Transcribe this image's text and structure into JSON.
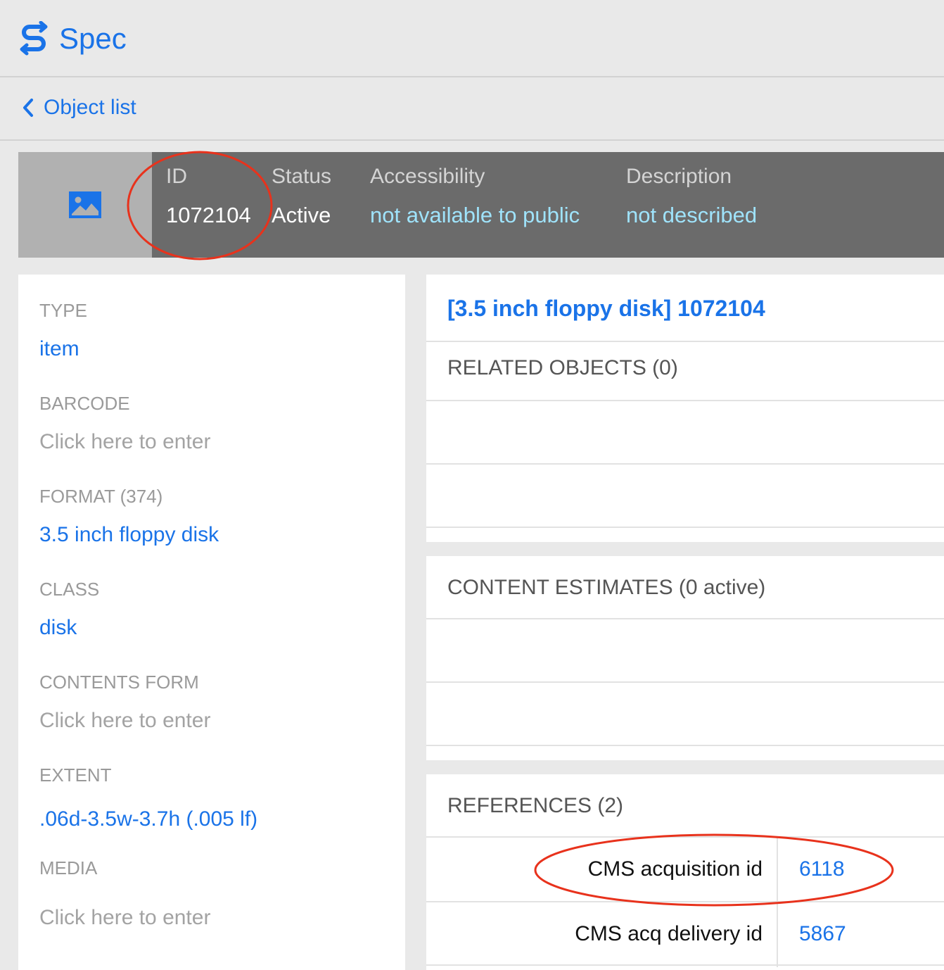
{
  "app": {
    "name": "Spec",
    "accent": "#1a73e8"
  },
  "nav": {
    "back_label": "Object list"
  },
  "header": {
    "id_label": "ID",
    "id_value": "1072104",
    "status_label": "Status",
    "status_value": "Active",
    "access_label": "Accessibility",
    "access_value": "not available to public",
    "desc_label": "Description",
    "desc_value": "not described"
  },
  "fields": [
    {
      "label": "TYPE",
      "value": "item"
    },
    {
      "label": "BARCODE",
      "value": "Click here to enter"
    },
    {
      "label": "FORMAT (374)",
      "value": "3.5 inch floppy disk"
    },
    {
      "label": "CLASS",
      "value": "disk"
    },
    {
      "label": "CONTENTS FORM",
      "value": "Click here to enter"
    },
    {
      "label": "EXTENT",
      "value": ".06d-3.5w-3.7h (.005 lf)"
    },
    {
      "label": "MEDIA",
      "value": "Click here to enter"
    }
  ],
  "object": {
    "title": "[3.5 inch floppy disk] 1072104"
  },
  "sections": {
    "related": "RELATED OBJECTS (0)",
    "estimates": "CONTENT ESTIMATES (0 active)",
    "references": "REFERENCES (2)"
  },
  "references": [
    {
      "key": "CMS acquisition id",
      "value": "6118"
    },
    {
      "key": "CMS acq delivery id",
      "value": "5867"
    }
  ],
  "annotation_color": "#e8321c"
}
